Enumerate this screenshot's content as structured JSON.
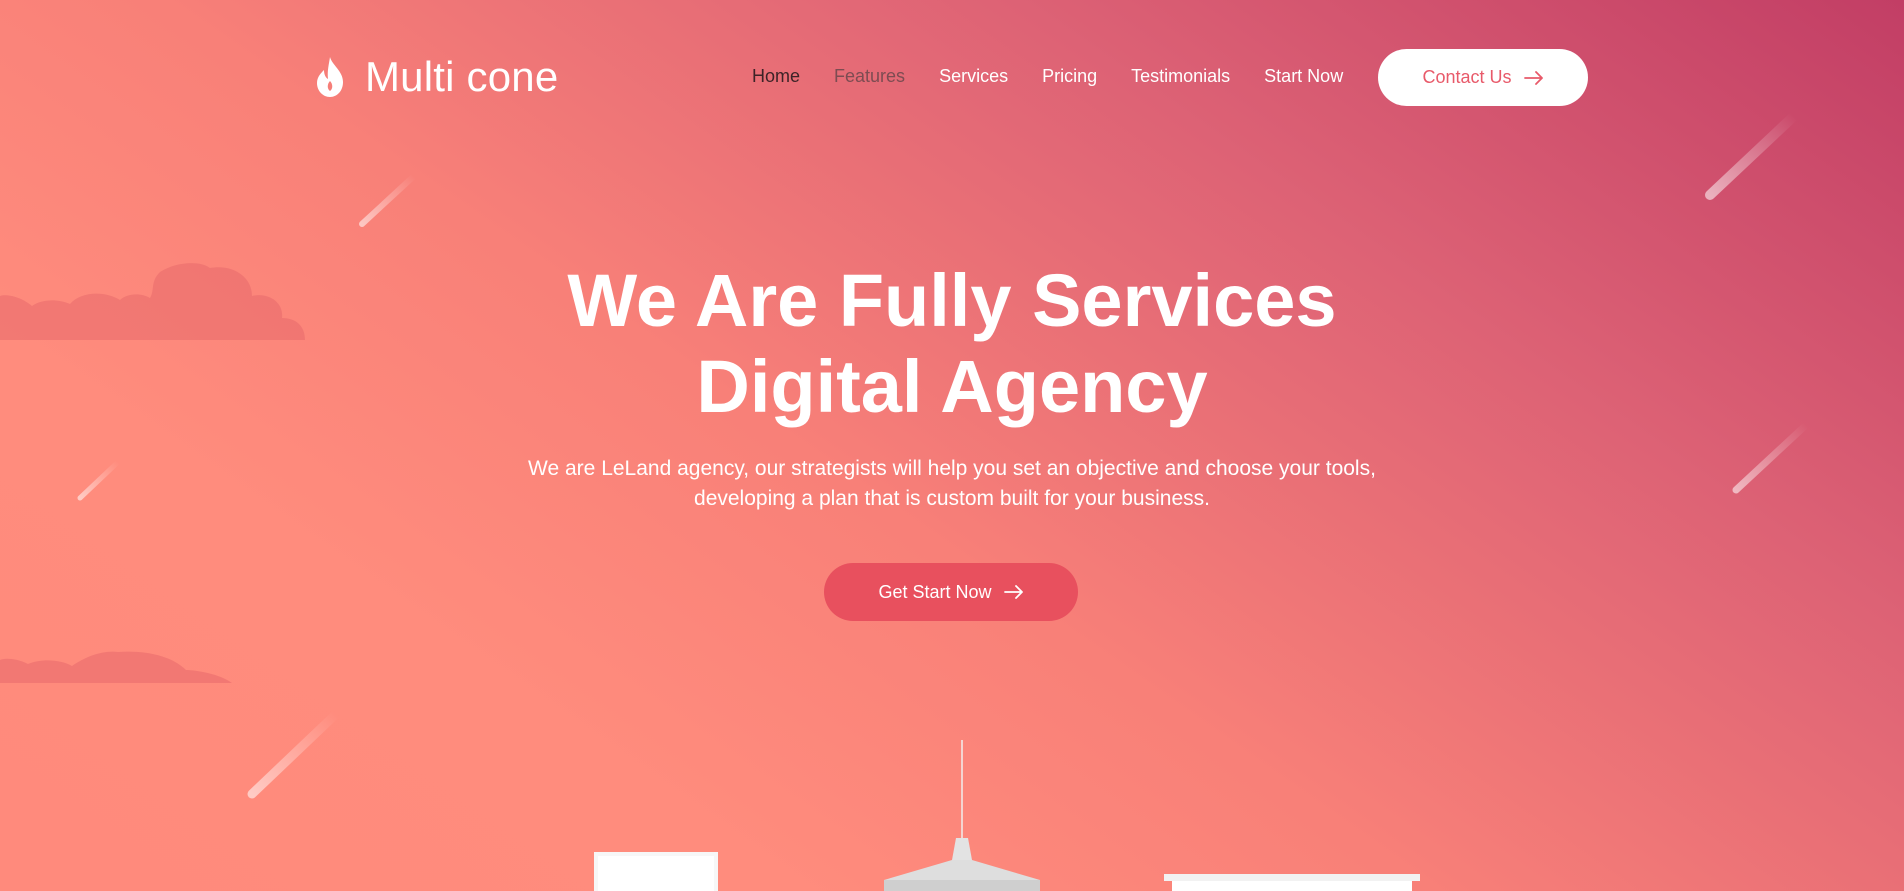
{
  "brand": {
    "name": "Multi cone",
    "icon": "flame-icon"
  },
  "nav": {
    "items": [
      {
        "label": "Home",
        "state": "active"
      },
      {
        "label": "Features",
        "state": "hover"
      },
      {
        "label": "Services",
        "state": "default"
      },
      {
        "label": "Pricing",
        "state": "default"
      },
      {
        "label": "Testimonials",
        "state": "default"
      },
      {
        "label": "Start Now",
        "state": "default"
      }
    ],
    "contact_label": "Contact Us",
    "contact_icon": "arrow-right-icon"
  },
  "hero": {
    "title_line1": "We Are Fully Services",
    "title_line2": "Digital Agency",
    "subtitle_line1": "We are LeLand agency, our strategists will help you set an objective and choose your tools,",
    "subtitle_line2": "developing a plan that is custom built for your business.",
    "cta_label": "Get Start Now",
    "cta_icon": "arrow-right-icon"
  },
  "colors": {
    "gradient_top_right": "#c23e65",
    "gradient_bottom_left": "#ff8a7c",
    "cta_button": "#e8505e",
    "contact_text": "#e85a6a",
    "nav_active": "#3d2327"
  }
}
